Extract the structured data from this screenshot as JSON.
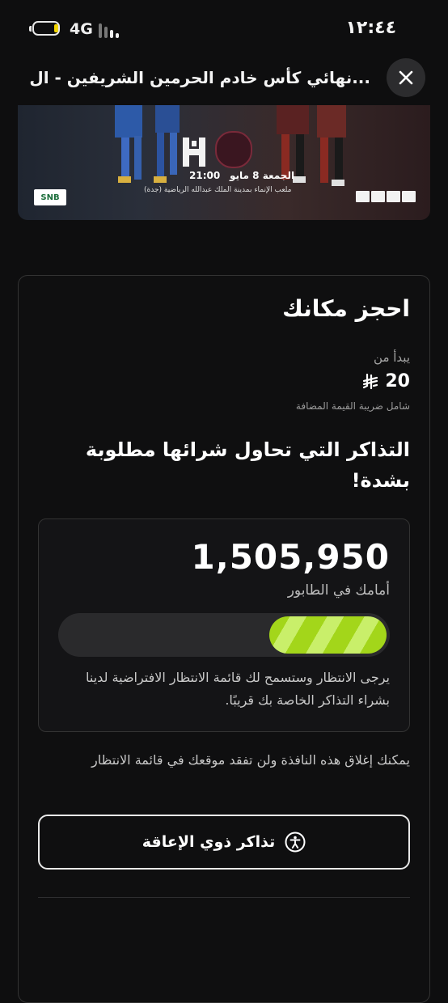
{
  "status_bar": {
    "network": "4G",
    "time": "١٢:٤٤",
    "battery_level": 0.2,
    "battery_color": "#f1d400"
  },
  "header": {
    "title": "نهائي كأس خادم الحرمين الشريفين - ال...",
    "close_icon": "close-icon"
  },
  "banner": {
    "time": "21:00",
    "date": "الجمعة 8 مايو",
    "venue": "ملعب الإنماء بمدينة الملك عبدالله الرياضية (جدة)",
    "sponsor": "SNB"
  },
  "booking": {
    "title": "احجز مكانك",
    "starts_from_label": "يبدأ من",
    "price": "20",
    "currency_icon": "riyal-icon",
    "vat_note": "شامل ضريبة القيمة المضافة",
    "demand_message": "التذاكر التي تحاول شرائها مطلوبة بشدة!"
  },
  "queue": {
    "ahead_count": "1,505,950",
    "ahead_label": "أمامك في الطابور",
    "progress_fraction": 0.36,
    "progress_color": "#a3d61a",
    "note": "يرجى الانتظار وستسمح لك قائمة الانتظار الافتراضية لدينا بشراء التذاكر الخاصة بك قريبًا."
  },
  "close_note": "يمكنك إغلاق هذه النافذة ولن تفقد موقعك في قائمة الانتظار",
  "accessibility_button": {
    "label": "تذاكر ذوي الإعاقة",
    "icon": "accessibility-icon"
  }
}
